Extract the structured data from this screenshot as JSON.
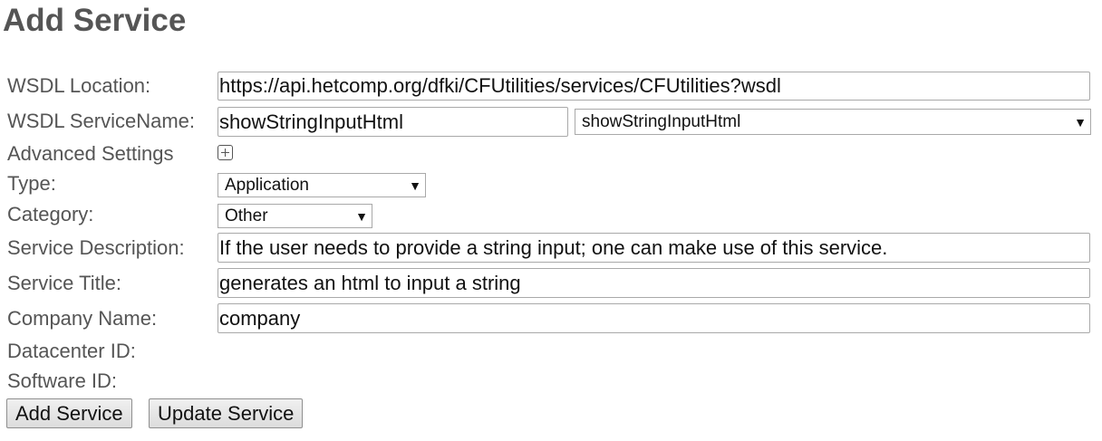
{
  "page": {
    "title": "Add Service"
  },
  "form": {
    "wsdl_location": {
      "label": "WSDL Location:",
      "value": "https://api.hetcomp.org/dfki/CFUtilities/services/CFUtilities?wsdl"
    },
    "wsdl_service_name": {
      "label": "WSDL ServiceName:",
      "value": "showStringInputHtml",
      "selected": "showStringInputHtml"
    },
    "advanced_settings": {
      "label": "Advanced Settings",
      "icon": "plus-square-icon"
    },
    "type": {
      "label": "Type:",
      "selected": "Application"
    },
    "category": {
      "label": "Category:",
      "selected": "Other"
    },
    "service_description": {
      "label": "Service Description:",
      "value": "If the user needs to provide a string input; one can make use of this service."
    },
    "service_title": {
      "label": "Service Title:",
      "value": "generates an html to input a string"
    },
    "company_name": {
      "label": "Company Name:",
      "value": "company"
    },
    "datacenter_id": {
      "label": "Datacenter ID:"
    },
    "software_id": {
      "label": "Software ID:"
    }
  },
  "buttons": {
    "add_service": "Add Service",
    "update_service": "Update Service"
  }
}
